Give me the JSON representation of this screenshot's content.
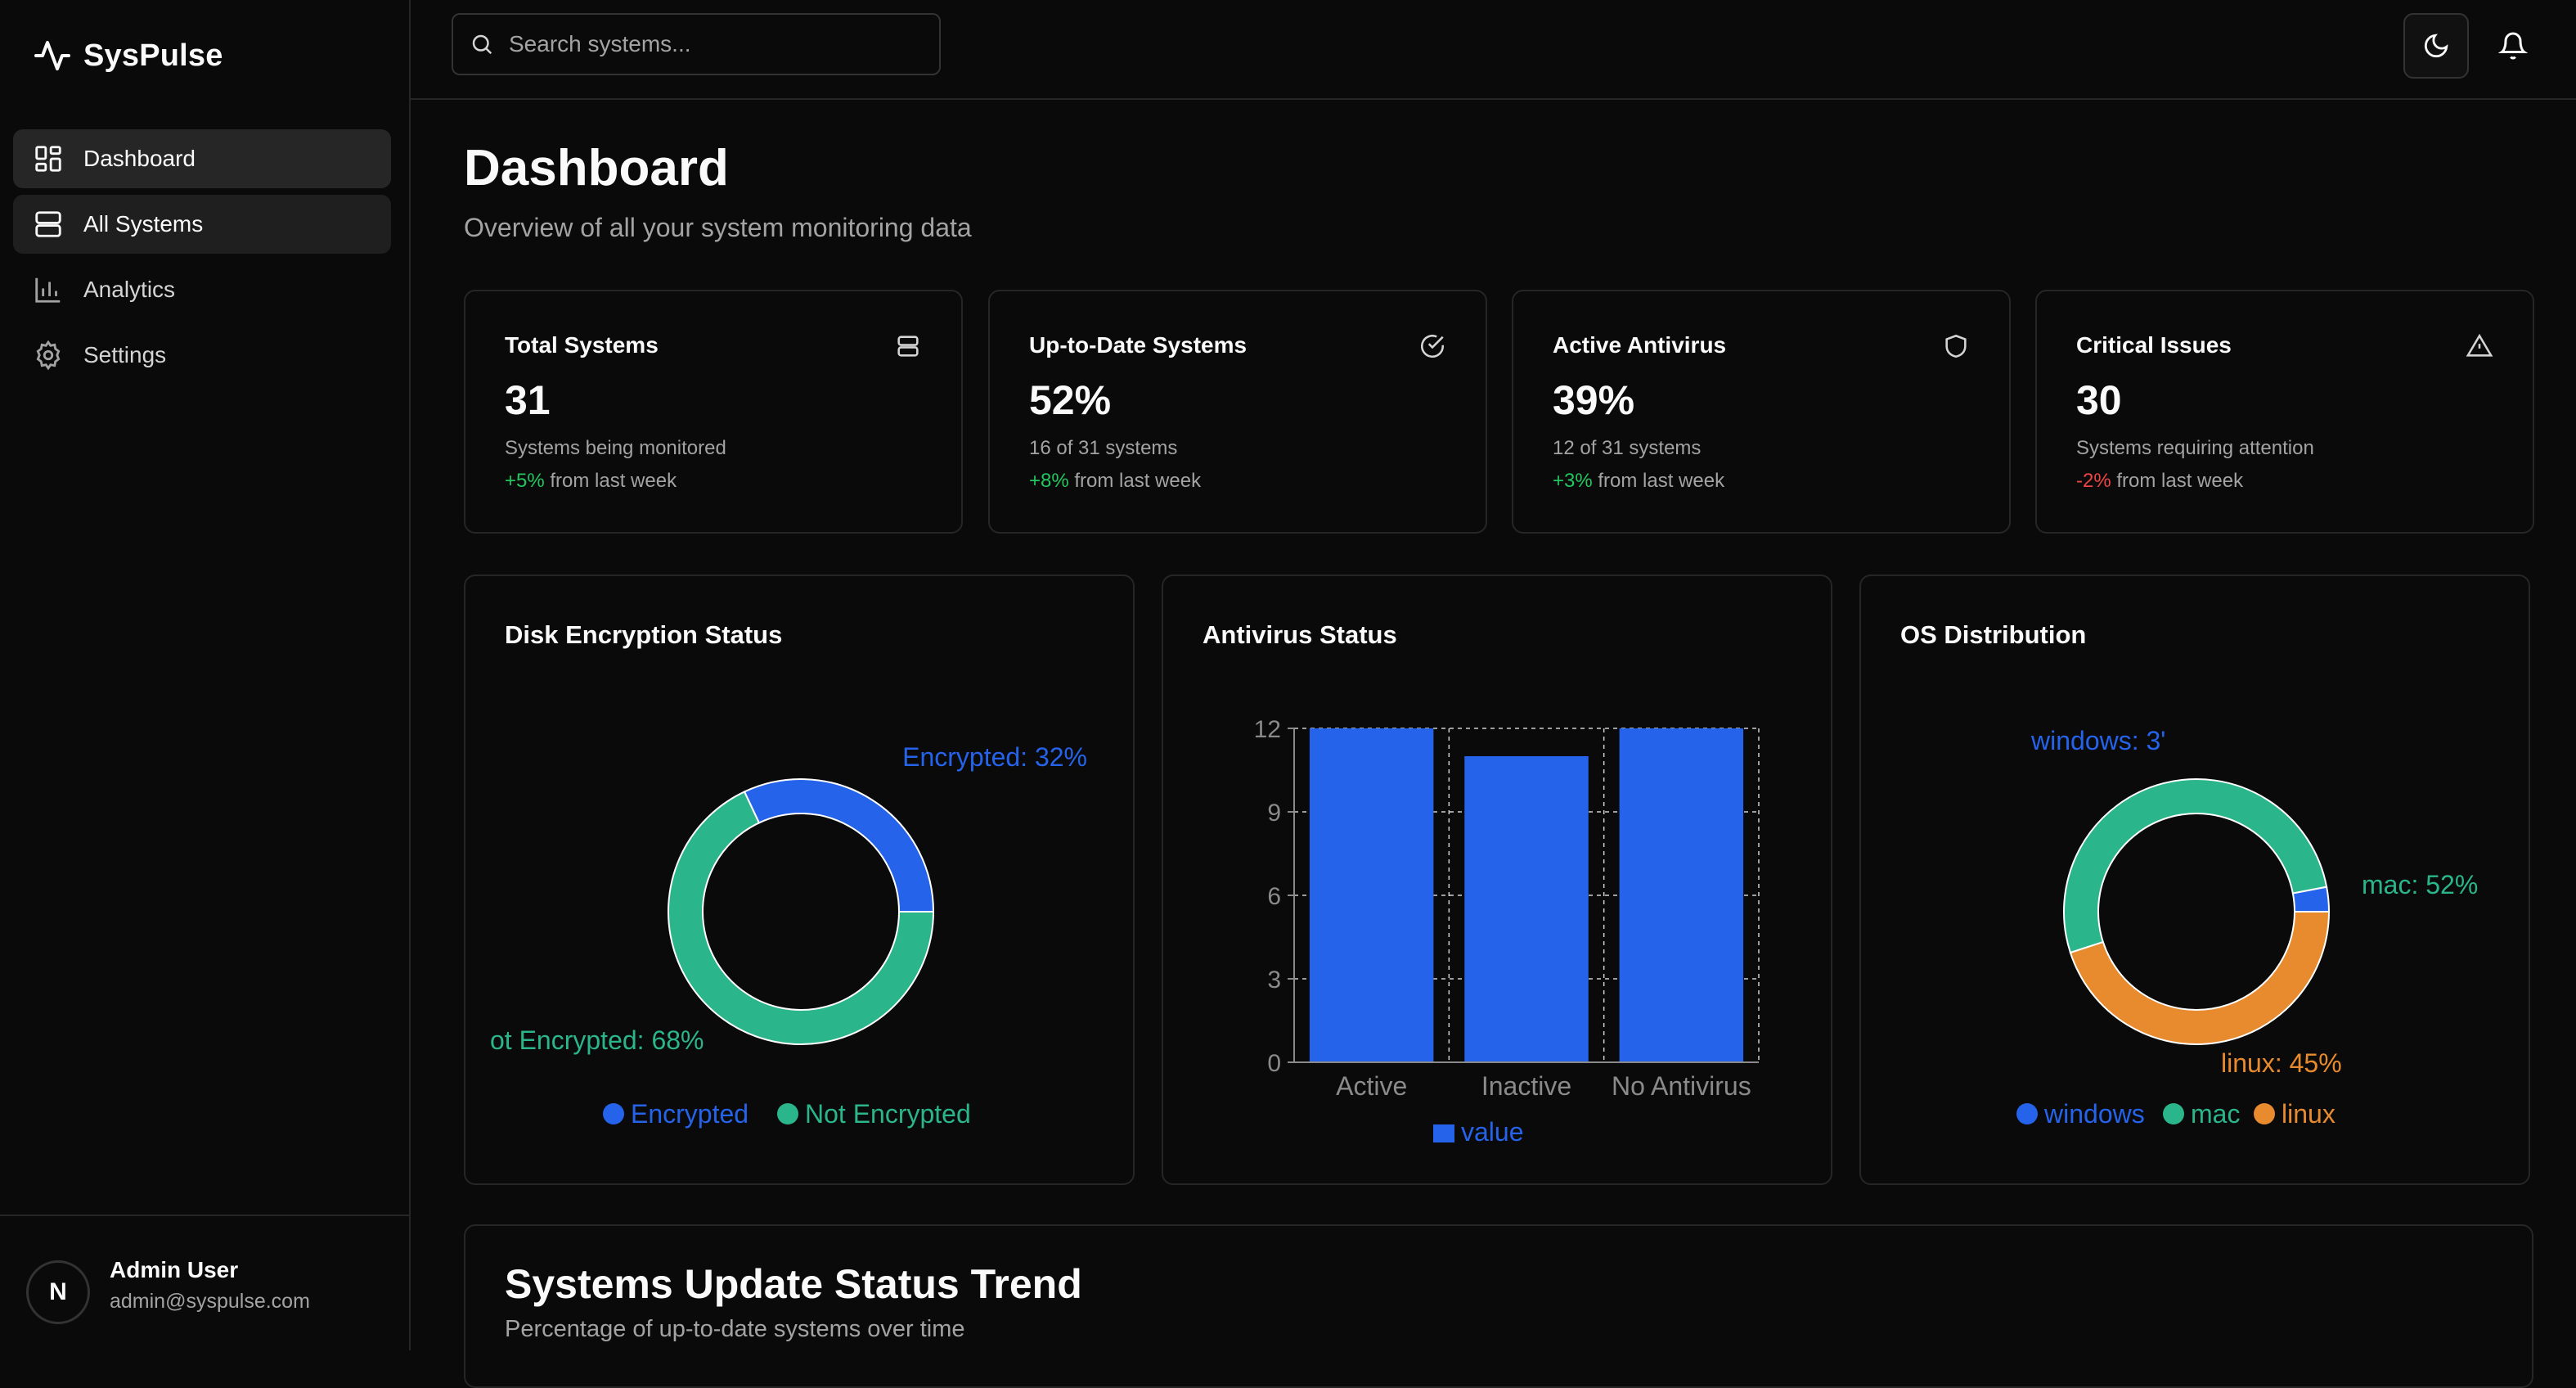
{
  "app": {
    "name": "SysPulse"
  },
  "sidebar": {
    "items": [
      {
        "label": "Dashboard",
        "icon": "dashboard-icon"
      },
      {
        "label": "All Systems",
        "icon": "server-icon"
      },
      {
        "label": "Analytics",
        "icon": "bar-chart-icon"
      },
      {
        "label": "Settings",
        "icon": "gear-icon"
      }
    ],
    "user": {
      "initial": "N",
      "name": "Admin User",
      "email": "admin@syspulse.com"
    }
  },
  "topbar": {
    "search_placeholder": "Search systems..."
  },
  "page": {
    "title": "Dashboard",
    "subtitle": "Overview of all your system monitoring data"
  },
  "stats": [
    {
      "title": "Total Systems",
      "value": "31",
      "desc": "Systems being monitored",
      "trend": "+5%",
      "trend_suffix": "from last week",
      "icon": "server-icon"
    },
    {
      "title": "Up-to-Date Systems",
      "value": "52%",
      "desc": "16 of 31 systems",
      "trend": "+8%",
      "trend_suffix": "from last week",
      "icon": "check-circle-icon"
    },
    {
      "title": "Active Antivirus",
      "value": "39%",
      "desc": "12 of 31 systems",
      "trend": "+3%",
      "trend_suffix": "from last week",
      "icon": "shield-icon"
    },
    {
      "title": "Critical Issues",
      "value": "30",
      "desc": "Systems requiring attention",
      "trend": "-2%",
      "trend_suffix": "from last week",
      "icon": "warning-icon"
    }
  ],
  "charts": {
    "disk": {
      "title": "Disk Encryption Status"
    },
    "antivirus": {
      "title": "Antivirus Status"
    },
    "os": {
      "title": "OS Distribution"
    }
  },
  "colors": {
    "blue": "#2563eb",
    "green": "#2bb58a",
    "orange": "#e88a2e",
    "positive": "#22c55e",
    "negative": "#ef4444"
  },
  "chart_data": [
    {
      "type": "pie",
      "title": "Disk Encryption Status",
      "slices": [
        {
          "name": "Encrypted",
          "value": 32,
          "label": "Encrypted: 32%",
          "color": "#2563eb"
        },
        {
          "name": "Not Encrypted",
          "value": 68,
          "label": "ot Encrypted: 68%",
          "color": "#2bb58a"
        }
      ],
      "legend": [
        "Encrypted",
        "Not Encrypted"
      ],
      "legend_position": "bottom"
    },
    {
      "type": "bar",
      "title": "Antivirus Status",
      "categories": [
        "Active",
        "Inactive",
        "No Antivirus"
      ],
      "series": [
        {
          "name": "value",
          "values": [
            12,
            11,
            12
          ],
          "color": "#2563eb"
        }
      ],
      "yticks": [
        "0",
        "3",
        "6",
        "9",
        "12"
      ],
      "ylim": [
        0,
        12
      ],
      "grid": true,
      "legend_position": "bottom"
    },
    {
      "type": "pie",
      "title": "OS Distribution",
      "slices": [
        {
          "name": "windows",
          "value": 3,
          "label": "windows: 3'",
          "color": "#2563eb"
        },
        {
          "name": "mac",
          "value": 52,
          "label": "mac: 52%",
          "color": "#2bb58a"
        },
        {
          "name": "linux",
          "value": 45,
          "label": "linux: 45%",
          "color": "#e88a2e"
        }
      ],
      "legend": [
        "windows",
        "mac",
        "linux"
      ],
      "legend_position": "bottom"
    }
  ],
  "trend": {
    "title": "Systems Update Status Trend",
    "subtitle": "Percentage of up-to-date systems over time"
  }
}
